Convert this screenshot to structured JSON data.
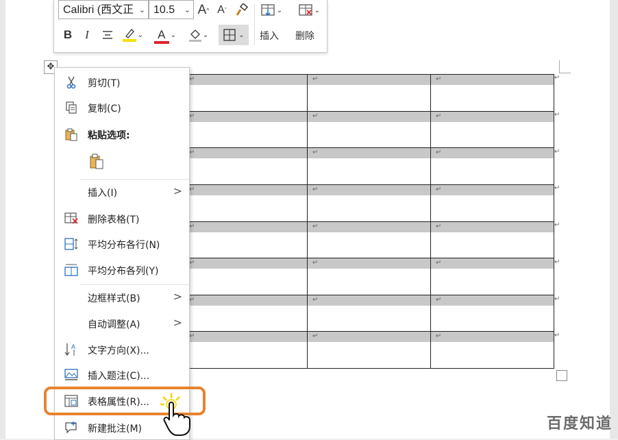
{
  "toolbar": {
    "font_name": "Calibri (西文正",
    "font_size": "10.5",
    "grow_font": "A",
    "shrink_font": "A",
    "bold": "B",
    "italic": "I",
    "font_color_letter": "A",
    "insert_label": "插入",
    "delete_label": "删除"
  },
  "context_menu": {
    "items": [
      {
        "label": "剪切(T)",
        "icon": "scissors-icon"
      },
      {
        "label": "复制(C)",
        "icon": "copy-icon"
      },
      {
        "label": "粘贴选项:",
        "icon": "paste-icon"
      },
      {
        "label": "插入(I)",
        "submenu": true
      },
      {
        "label": "删除表格(T)",
        "icon": "delete-table-icon"
      },
      {
        "label": "平均分布各行(N)",
        "icon": "distribute-rows-icon"
      },
      {
        "label": "平均分布各列(Y)",
        "icon": "distribute-columns-icon"
      },
      {
        "label": "边框样式(B)",
        "submenu": true
      },
      {
        "label": "自动调整(A)",
        "submenu": true
      },
      {
        "label": "文字方向(X)...",
        "icon": "text-direction-icon"
      },
      {
        "label": "插入题注(C)...",
        "icon": "insert-caption-icon"
      },
      {
        "label": "表格属性(R)...",
        "icon": "table-properties-icon"
      },
      {
        "label": "新建批注(M)",
        "icon": "new-comment-icon"
      }
    ],
    "submenu_arrow": ">"
  },
  "table": {
    "rows": 8,
    "columns": 3,
    "cell_mark": "↵"
  },
  "colors": {
    "highlight_ring": "#e8832f",
    "highlighter_yellow": "#f5e000",
    "font_color_red": "#d9252b",
    "row_shade": "#c8c8c8"
  },
  "watermark": "百度知道"
}
